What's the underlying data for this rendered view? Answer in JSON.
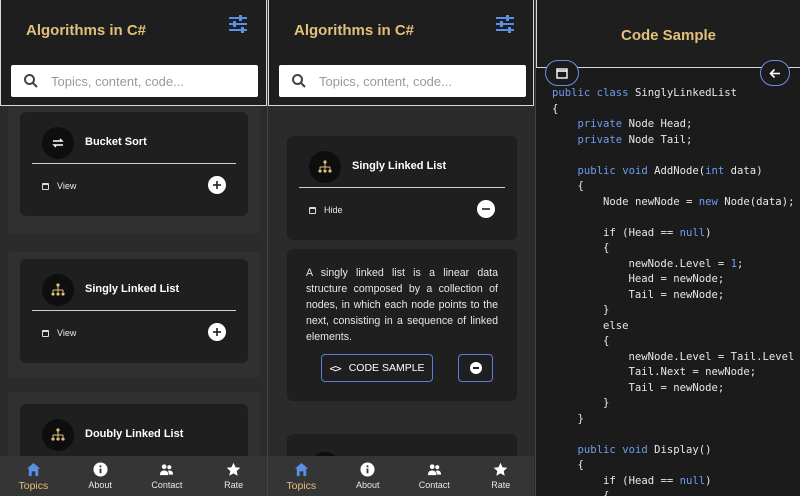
{
  "app_title": "Algorithms in C#",
  "search": {
    "placeholder": "Topics, content, code..."
  },
  "panel1": {
    "cards": [
      {
        "title": "Bucket Sort",
        "toggle": "View",
        "icon": "bucket-sort-icon"
      },
      {
        "title": "Singly Linked List",
        "toggle": "View",
        "icon": "tree-icon"
      },
      {
        "title": "Doubly Linked List",
        "icon": "tree-icon"
      }
    ]
  },
  "panel2": {
    "card": {
      "title": "Singly Linked List",
      "toggle": "Hide",
      "icon": "tree-icon"
    },
    "description": "A singly linked list is a linear data structure composed by a collection of nodes, in which each node points to the next, consisting in a sequence of linked elements.",
    "code_sample_button": "CODE SAMPLE"
  },
  "nav": [
    {
      "label": "Topics",
      "icon": "home-icon",
      "active": true
    },
    {
      "label": "About",
      "icon": "info-icon",
      "active": false
    },
    {
      "label": "Contact",
      "icon": "contact-icon",
      "active": false
    },
    {
      "label": "Rate",
      "icon": "star-icon",
      "active": false
    }
  ],
  "code_screen": {
    "title": "Code Sample",
    "code_lines": [
      "public class SinglyLinkedList",
      "{",
      "    private Node Head;",
      "    private Node Tail;",
      "",
      "    public void AddNode(int data)",
      "    {",
      "        Node newNode = new Node(data);",
      "",
      "        if (Head == null)",
      "        {",
      "            newNode.Level = 1;",
      "            Head = newNode;",
      "            Tail = newNode;",
      "        }",
      "        else",
      "        {",
      "            newNode.Level = Tail.Level +",
      "            Tail.Next = newNode;",
      "            Tail = newNode;",
      "        }",
      "    }",
      "",
      "    public void Display()",
      "    {",
      "        if (Head == null)",
      "        {"
    ]
  },
  "colors": {
    "accent": "#e2c07c",
    "blue": "#5a7fd9",
    "card": "#1f1f1f",
    "keyword": "#6d9cf0"
  }
}
